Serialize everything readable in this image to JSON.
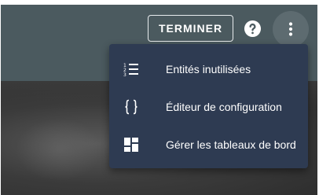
{
  "toolbar": {
    "finish_label": "TERMINER",
    "help_icon": "help-circle-icon",
    "more_icon": "dots-vertical-icon"
  },
  "menu": {
    "items": [
      {
        "label": "Entités inutilisées",
        "icon": "format-list-numbered-icon"
      },
      {
        "label": "Éditeur de configuration",
        "icon": "code-braces-icon"
      },
      {
        "label": "Gérer les tableaux de bord",
        "icon": "view-dashboard-icon"
      }
    ]
  },
  "colors": {
    "toolbar": "#4b5a5f",
    "menu_background": "#2e3b52",
    "text": "#ffffff"
  }
}
